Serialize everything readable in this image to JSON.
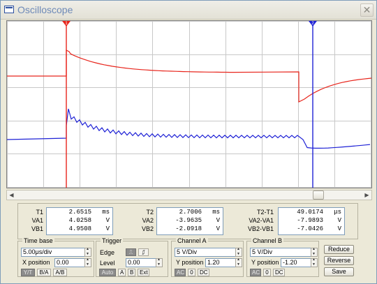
{
  "window": {
    "title": "Oscilloscope",
    "close_glyph": "✕"
  },
  "colors": {
    "channel_a": "#E8251C",
    "channel_b": "#1F22D6",
    "cursor_1": "#E8251C",
    "cursor_2": "#1F22D6",
    "grid": "#C8C8C8",
    "background": "#FFFFFF"
  },
  "cursor_readout": {
    "t1": {
      "label": "T1",
      "value": "2.6515",
      "unit": "ms"
    },
    "va1": {
      "label": "VA1",
      "value": "4.0258",
      "unit": "V"
    },
    "vb1": {
      "label": "VB1",
      "value": "4.9508",
      "unit": "V"
    },
    "t2": {
      "label": "T2",
      "value": "2.7006",
      "unit": "ms"
    },
    "va2": {
      "label": "VA2",
      "value": "-3.9635",
      "unit": "V"
    },
    "vb2": {
      "label": "VB2",
      "value": "-2.0918",
      "unit": "V"
    },
    "dt": {
      "label": "T2-T1",
      "value": "49.0174",
      "unit": "μs"
    },
    "dva": {
      "label": "VA2-VA1",
      "value": "-7.9893",
      "unit": "V"
    },
    "dvb": {
      "label": "VB2-VB1",
      "value": "-7.0426",
      "unit": "V"
    }
  },
  "timebase": {
    "title": "Time base",
    "scale": "5.00μs/div",
    "x_position_label": "X position",
    "x_position": "0.00",
    "modes": [
      "Y/T",
      "B/A",
      "A/B"
    ],
    "active_mode": "Y/T"
  },
  "trigger": {
    "title": "Trigger",
    "edge_label": "Edge",
    "edge_rising": "⎍",
    "edge_falling": "⎎",
    "level_label": "Level",
    "level": "0.00",
    "sources": [
      "Auto",
      "A",
      "B",
      "Ext"
    ],
    "active_source": "Auto"
  },
  "channel_a": {
    "title": "Channel A",
    "scale": "5 V/Div",
    "y_position_label": "Y position",
    "y_position": "1.20",
    "couplings": [
      "AC",
      "0",
      "DC"
    ],
    "active_coupling": "AC"
  },
  "channel_b": {
    "title": "Channel B",
    "scale": "5 V/Div",
    "y_position_label": "Y position",
    "y_position": "-1.20",
    "couplings": [
      "AC",
      "0",
      "DC"
    ],
    "active_coupling": "AC"
  },
  "buttons": {
    "reduce": "Reduce",
    "reverse": "Reverse",
    "save": "Save"
  },
  "scroll": {
    "left_arrow": "◀",
    "right_arrow": "▶"
  },
  "cursor_markers": {
    "cursor_1": "1",
    "cursor_2": "2"
  }
}
